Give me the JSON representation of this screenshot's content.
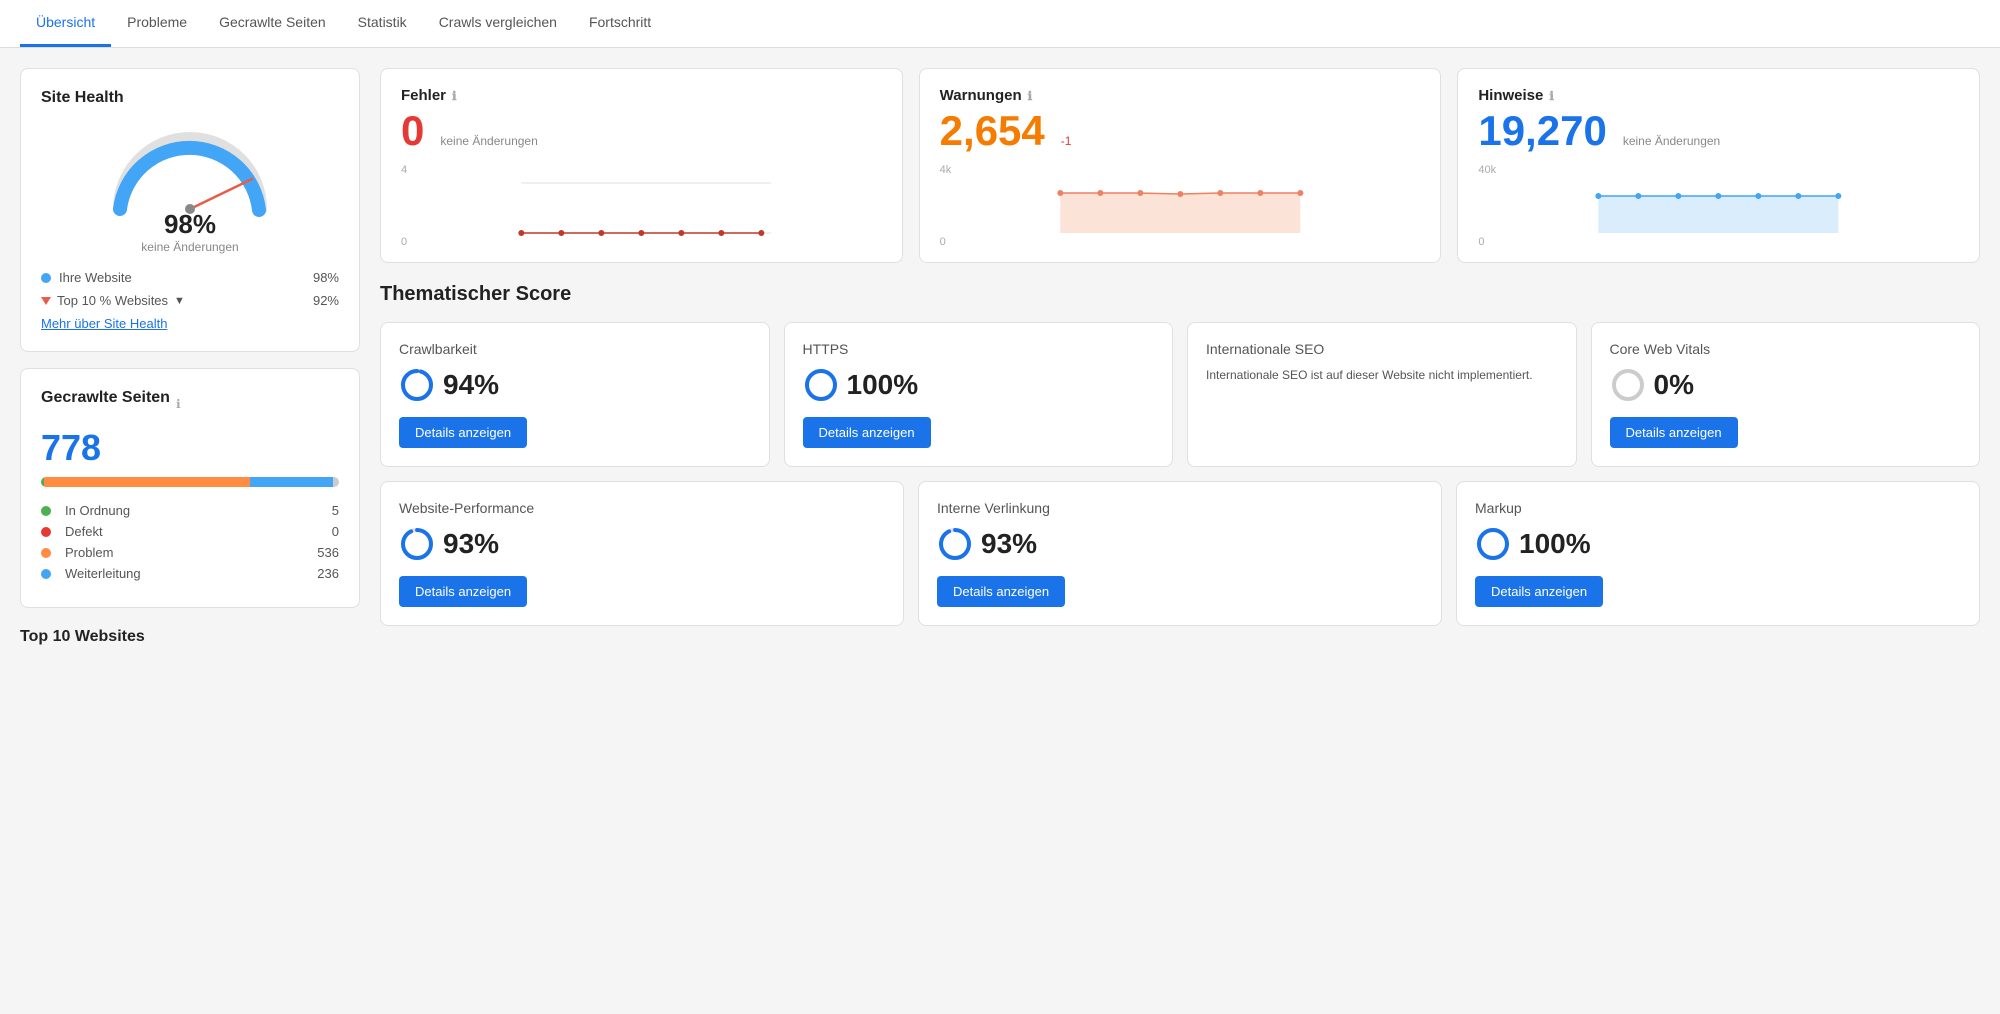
{
  "nav": {
    "items": [
      {
        "label": "Übersicht",
        "active": true
      },
      {
        "label": "Probleme",
        "active": false
      },
      {
        "label": "Gecrawlte Seiten",
        "active": false
      },
      {
        "label": "Statistik",
        "active": false
      },
      {
        "label": "Crawls vergleichen",
        "active": false
      },
      {
        "label": "Fortschritt",
        "active": false
      }
    ]
  },
  "site_health": {
    "title": "Site Health",
    "percent": "98%",
    "sub": "keine Änderungen",
    "legend": [
      {
        "label": "Ihre Website",
        "value": "98%",
        "color": "#42a5f5",
        "type": "dot"
      },
      {
        "label": "Top 10 % Websites",
        "value": "92%",
        "color": "#e85c4a",
        "type": "triangle"
      }
    ],
    "more_link": "Mehr über Site Health"
  },
  "gecrawlte_seiten": {
    "title": "Gecrawlte Seiten",
    "number": "778",
    "stats": [
      {
        "label": "In Ordnung",
        "value": "5",
        "color": "#4caf50"
      },
      {
        "label": "Defekt",
        "value": "0",
        "color": "#e53935"
      },
      {
        "label": "Problem",
        "value": "536",
        "color": "#ff8c42"
      },
      {
        "label": "Weiterleitung",
        "value": "236",
        "color": "#42a5f5"
      }
    ]
  },
  "top_websites_label": "Top 10 Websites",
  "metrics": {
    "fehler": {
      "title": "Fehler",
      "value": "0",
      "change": "keine Änderungen",
      "chart_top": "4",
      "chart_bot": "0"
    },
    "warnungen": {
      "title": "Warnungen",
      "value": "2,654",
      "change": "-1",
      "chart_top": "4k",
      "chart_bot": "0"
    },
    "hinweise": {
      "title": "Hinweise",
      "value": "19,270",
      "change": "keine Änderungen",
      "chart_top": "40k",
      "chart_bot": "0"
    }
  },
  "thematischer_score": {
    "title": "Thematischer Score",
    "cards_row1": [
      {
        "title": "Crawlbarkeit",
        "percent": "94%",
        "circle_color": "#1a73e8",
        "circle_fill": 94,
        "btn_label": "Details anzeigen",
        "note": ""
      },
      {
        "title": "HTTPS",
        "percent": "100%",
        "circle_color": "#1a73e8",
        "circle_fill": 100,
        "btn_label": "Details anzeigen",
        "note": ""
      },
      {
        "title": "Internationale SEO",
        "percent": "",
        "circle_color": "#1a73e8",
        "circle_fill": 0,
        "btn_label": "",
        "note": "Internationale SEO ist auf dieser Website nicht implementiert."
      },
      {
        "title": "Core Web Vitals",
        "percent": "0%",
        "circle_color": "#ccc",
        "circle_fill": 0,
        "btn_label": "Details anzeigen",
        "note": ""
      }
    ],
    "cards_row2": [
      {
        "title": "Website-Performance",
        "percent": "93%",
        "circle_color": "#1a73e8",
        "circle_fill": 93,
        "btn_label": "Details anzeigen",
        "note": ""
      },
      {
        "title": "Interne Verlinkung",
        "percent": "93%",
        "circle_color": "#1a73e8",
        "circle_fill": 93,
        "btn_label": "Details anzeigen",
        "note": ""
      },
      {
        "title": "Markup",
        "percent": "100%",
        "circle_color": "#1a73e8",
        "circle_fill": 100,
        "btn_label": "Details anzeigen",
        "note": ""
      }
    ]
  }
}
